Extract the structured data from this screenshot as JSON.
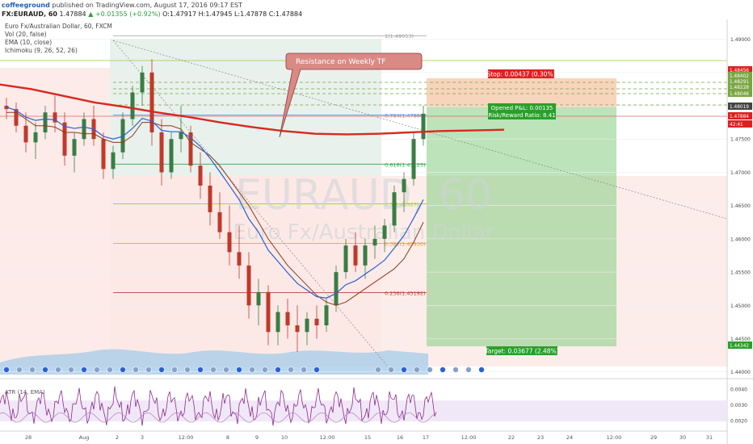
{
  "header": {
    "user": "coffeeground",
    "published": "published on TradingView.com, August 17, 2016 09:17 EST",
    "symbol": "FX:EURAUD, 60",
    "open": "O:1.47917",
    "high": "H:1.47945",
    "low": "L:1.47878",
    "close": "C:1.47884",
    "last": "1.47884",
    "change": "+0.01355 (+0.92%)"
  },
  "indicators": {
    "title": "Euro Fx/Australian Dollar, 60, FXCM",
    "vol": "Vol (20, false)",
    "ema": "EMA (10, close)",
    "ichimoku": "Ichimoku (9, 26, 52, 26)"
  },
  "watermark": {
    "symbol": "EURAUD, 60",
    "name": "Euro Fx/Australian Dollar"
  },
  "annotation": {
    "text": "Resistance on Weekly TF"
  },
  "position": {
    "stop": "Stop: 0.00437 (0.30%)",
    "pnl": "Opened P&L: 0.00135",
    "rr": "Risk/Reward Ratio: 8.41",
    "target": "Target: 0.03677 (2.48%)"
  },
  "oscillator": {
    "label": "ATR (14, EMA)"
  },
  "colors": {
    "candle_up": "#3a7d44",
    "candle_down": "#c0392b",
    "ema": "#2d5fd3",
    "ichimoku": "#8b3a1a",
    "ma_long": "#d9281e",
    "target_zone": "#8fd18a",
    "stop_zone": "#f6c5a6",
    "stop_label": "#e02020",
    "target_label": "#2aa02a",
    "osc_line": "#8a2a8e"
  },
  "chart_data": {
    "type": "candlestick",
    "symbol": "FX:EURAUD",
    "timeframe": "60",
    "ylim": [
      1.4396,
      1.4925
    ],
    "y_ticks": [
      "1.49000",
      "1.48500",
      "1.48000",
      "1.47500",
      "1.47000",
      "1.46500",
      "1.46000",
      "1.45500",
      "1.45000",
      "1.44500",
      "1.44000"
    ],
    "x_ticks": [
      "28",
      "Aug",
      "2",
      "3",
      "12:00",
      "8",
      "9",
      "10",
      "12:00",
      "15",
      "16",
      "17",
      "12:00",
      "22",
      "23",
      "24",
      "12:00",
      "29",
      "30",
      "31"
    ],
    "price_labels": [
      "1.48456",
      "1.48402",
      "1.48291",
      "1.48228",
      "1.48046",
      "1.48019",
      "1.47884",
      "42:41",
      "1.44342"
    ],
    "fibonacci": [
      {
        "label": "1(1.49053)",
        "level": 1.49053
      },
      {
        "label": "0.764(1.47860)",
        "level": 1.4786
      },
      {
        "label": "0.618(1.47123)",
        "level": 1.47123
      },
      {
        "label": "0.5(1.46527)",
        "level": 1.46527
      },
      {
        "label": "0.382(1.45930)",
        "level": 1.4593
      },
      {
        "label": "0.236(1.45192)",
        "level": 1.45192
      }
    ],
    "series": [
      {
        "name": "EURAUD",
        "values": [
          [
            1.48,
            1.4812,
            1.478,
            1.4795
          ],
          [
            1.4795,
            1.4805,
            1.476,
            1.477
          ],
          [
            1.477,
            1.479,
            1.473,
            1.4745
          ],
          [
            1.4745,
            1.4775,
            1.472,
            1.476
          ],
          [
            1.476,
            1.48,
            1.475,
            1.479
          ],
          [
            1.479,
            1.4815,
            1.476,
            1.4775
          ],
          [
            1.4775,
            1.479,
            1.471,
            1.4725
          ],
          [
            1.4725,
            1.476,
            1.47,
            1.475
          ],
          [
            1.475,
            1.479,
            1.474,
            1.478
          ],
          [
            1.478,
            1.48,
            1.474,
            1.475
          ],
          [
            1.475,
            1.476,
            1.469,
            1.4705
          ],
          [
            1.4705,
            1.474,
            1.469,
            1.473
          ],
          [
            1.473,
            1.479,
            1.472,
            1.478
          ],
          [
            1.478,
            1.483,
            1.477,
            1.482
          ],
          [
            1.482,
            1.486,
            1.48,
            1.485
          ],
          [
            1.485,
            1.487,
            1.474,
            1.476
          ],
          [
            1.476,
            1.478,
            1.468,
            1.47
          ],
          [
            1.47,
            1.476,
            1.469,
            1.475
          ],
          [
            1.475,
            1.48,
            1.473,
            1.476
          ],
          [
            1.476,
            1.477,
            1.47,
            1.471
          ],
          [
            1.471,
            1.473,
            1.466,
            1.468
          ],
          [
            1.468,
            1.47,
            1.462,
            1.464
          ],
          [
            1.464,
            1.467,
            1.46,
            1.461
          ],
          [
            1.461,
            1.465,
            1.456,
            1.458
          ],
          [
            1.458,
            1.462,
            1.454,
            1.456
          ],
          [
            1.456,
            1.458,
            1.448,
            1.45
          ],
          [
            1.45,
            1.454,
            1.447,
            1.452
          ],
          [
            1.452,
            1.453,
            1.444,
            1.446
          ],
          [
            1.446,
            1.45,
            1.444,
            1.449
          ],
          [
            1.449,
            1.451,
            1.445,
            1.447
          ],
          [
            1.447,
            1.45,
            1.443,
            1.446
          ],
          [
            1.446,
            1.449,
            1.444,
            1.448
          ],
          [
            1.448,
            1.45,
            1.445,
            1.447
          ],
          [
            1.447,
            1.451,
            1.446,
            1.45
          ],
          [
            1.45,
            1.456,
            1.449,
            1.455
          ],
          [
            1.455,
            1.46,
            1.454,
            1.459
          ],
          [
            1.459,
            1.461,
            1.455,
            1.456
          ],
          [
            1.456,
            1.46,
            1.454,
            1.459
          ],
          [
            1.459,
            1.462,
            1.457,
            1.46
          ],
          [
            1.46,
            1.463,
            1.458,
            1.462
          ],
          [
            1.462,
            1.468,
            1.461,
            1.467
          ],
          [
            1.467,
            1.47,
            1.464,
            1.469
          ],
          [
            1.469,
            1.476,
            1.468,
            1.475
          ],
          [
            1.475,
            1.48,
            1.474,
            1.4788
          ]
        ]
      },
      {
        "name": "EMA (10, close)",
        "values": [
          1.4798,
          1.4793,
          1.4783,
          1.4778,
          1.478,
          1.4779,
          1.4769,
          1.4766,
          1.4768,
          1.4765,
          1.4754,
          1.475,
          1.4754,
          1.4766,
          1.4781,
          1.4777,
          1.4763,
          1.4761,
          1.4761,
          1.4752,
          1.4739,
          1.4721,
          1.4701,
          1.468,
          1.4659,
          1.463,
          1.461,
          1.4583,
          1.4566,
          1.4549,
          1.4533,
          1.4523,
          1.4513,
          1.4511,
          1.4518,
          1.4531,
          1.4537,
          1.4547,
          1.4557,
          1.4568,
          1.4586,
          1.4605,
          1.4631,
          1.4659
        ]
      },
      {
        "name": "Ichimoku (9, 26, 52, 26)",
        "values": [
          1.479,
          1.479,
          1.478,
          1.477,
          1.477,
          1.4768,
          1.476,
          1.476,
          1.4758,
          1.4758,
          1.475,
          1.4745,
          1.4745,
          1.4755,
          1.4775,
          1.4775,
          1.477,
          1.477,
          1.4765,
          1.4745,
          1.4735,
          1.4725,
          1.471,
          1.469,
          1.467,
          1.465,
          1.4625,
          1.46,
          1.458,
          1.456,
          1.4545,
          1.453,
          1.4515,
          1.4505,
          1.45,
          1.4505,
          1.4515,
          1.4525,
          1.4535,
          1.4545,
          1.4555,
          1.457,
          1.4595,
          1.4625
        ]
      },
      {
        "name": "MA",
        "values": [
          1.4832,
          1.4825,
          1.4815,
          1.4805,
          1.4798,
          1.479,
          1.4783,
          1.4775,
          1.4768,
          1.4762,
          1.4758,
          1.4757,
          1.4758,
          1.476,
          1.4762,
          1.4763,
          1.4764
        ]
      }
    ],
    "trade": {
      "entry": 1.48019,
      "stop": 1.48456,
      "target": 1.44342
    },
    "oscillator": {
      "name": "ATR (14, EMA)",
      "ylim": [
        0.0016,
        0.0044
      ],
      "ticks": [
        "0.0040",
        "0.0030",
        "0.0020"
      ]
    }
  }
}
